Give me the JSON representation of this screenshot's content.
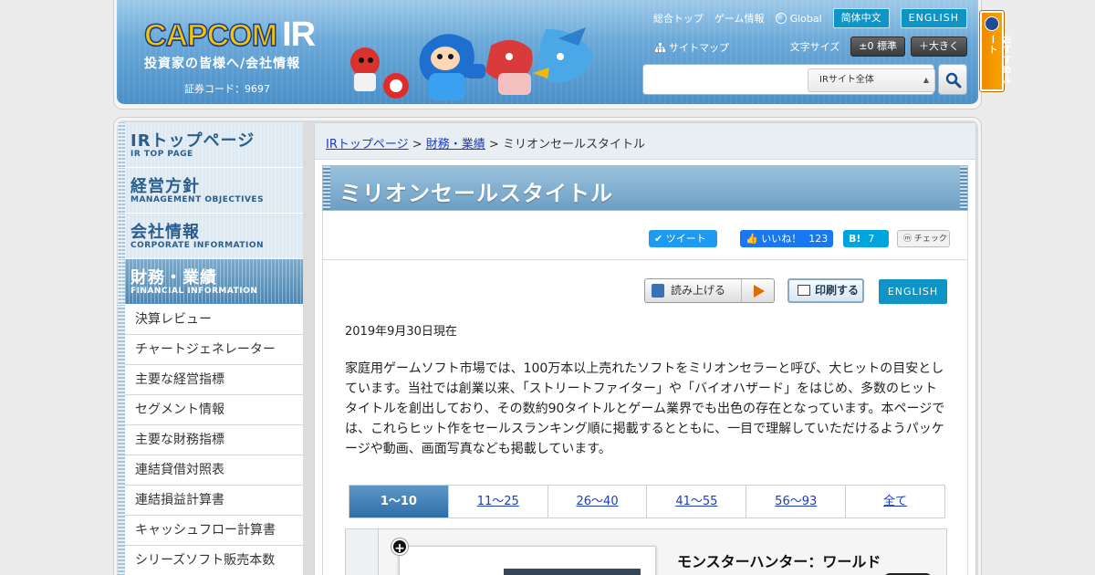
{
  "header": {
    "logo": {
      "brand": "CAPCOM",
      "suffix": "IR",
      "subtitle": "投資家の皆様へ/会社情報",
      "stock_code": "証券コード：9697"
    },
    "nav": {
      "top": "総合トップ",
      "games": "ゲーム情報",
      "global": "Global",
      "chinese": "简体中文",
      "english": "ENGLISH",
      "sitemap": "サイトマップ",
      "font_size_label": "文字サイズ",
      "font_standard": "±0 標準",
      "font_large": "＋大きく"
    },
    "search": {
      "placeholder": "",
      "scope": "IRサイト全体"
    },
    "recommend_tab": "おすすめルート"
  },
  "sidebar": {
    "sections": [
      {
        "ja": "IRトップページ",
        "en": "IR TOP PAGE"
      },
      {
        "ja": "経営方針",
        "en": "MANAGEMENT OBJECTIVES"
      },
      {
        "ja": "会社情報",
        "en": "CORPORATE INFORMATION"
      },
      {
        "ja": "財務・業績",
        "en": "FINANCIAL INFORMATION"
      }
    ],
    "items": [
      "決算レビュー",
      "チャートジェネレーター",
      "主要な経営指標",
      "セグメント情報",
      "主要な財務指標",
      "連結貸借対照表",
      "連結損益計算書",
      "キャッシュフロー計算書",
      "シリーズソフト販売本数"
    ]
  },
  "breadcrumb": {
    "home": "IRトップページ",
    "sep1": " > ",
    "section": "財務・業績",
    "sep2": " > ",
    "current": "ミリオンセールスタイトル"
  },
  "page_title": "ミリオンセールスタイトル",
  "social": {
    "tweet": "ツイート",
    "like": "いいね！",
    "like_count": "123",
    "hatena": "B!",
    "hatena_count": "7",
    "mixi": "チェック"
  },
  "tools": {
    "read_aloud": "読み上げる",
    "print": "印刷する",
    "english": "ENGLISH"
  },
  "content": {
    "date": "2019年9月30日現在",
    "description": "家庭用ゲームソフト市場では、100万本以上売れたソフトをミリオンセラーと呼び、大ヒットの目安としています。当社では創業以来、「ストリートファイター」や「バイオハザード」をはじめ、多数のヒットタイトルを創出しており、その数約90タイトルとゲーム業界でも出色の存在となっています。本ページでは、これらヒット作をセールスランキング順に掲載するとともに、一目で理解していただけるようパッケージや動画、画面写真なども掲載しています。"
  },
  "rank_tabs": [
    "1～10",
    "11～25",
    "26～40",
    "41～55",
    "56～93",
    "全て"
  ],
  "first_game": {
    "title": "モンスターハンター：ワールド"
  },
  "colors": {
    "accent_blue": "#0f94c6",
    "link": "#1a3cc0",
    "active_tab": "#2f6fa8",
    "recommend": "#f08a00"
  }
}
